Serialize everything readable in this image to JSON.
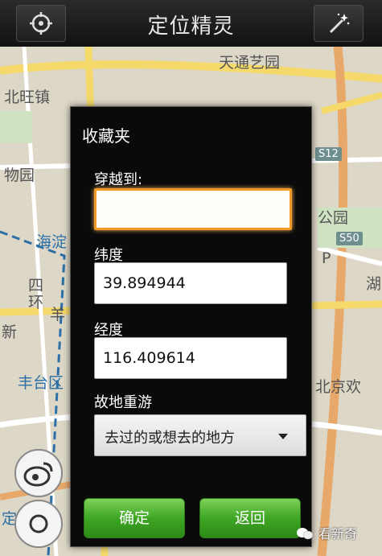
{
  "app": {
    "title": "定位精灵"
  },
  "map": {
    "labels": [
      "天通艺园",
      "北旺镇",
      "物园",
      "海淀",
      "公园",
      "四",
      "环",
      "羊",
      "新",
      "丰台区",
      "北京欢",
      "定河",
      "P",
      "湖"
    ],
    "road_badges": [
      "S12",
      "S50"
    ]
  },
  "dialog": {
    "title": "收藏夹",
    "goto_label": "穿越到:",
    "goto_value": "",
    "lat_label": "纬度",
    "lat_value": "39.894944",
    "lng_label": "经度",
    "lng_value": "116.409614",
    "revisit_label": "故地重游",
    "revisit_selected": "去过的或想去的地方",
    "ok_label": "确定",
    "back_label": "返回"
  },
  "watermark": {
    "text": "看新奇"
  },
  "colors": {
    "focus_border": "#f39b2a",
    "button_green": "#3ea624",
    "dialog_bg": "#0a0a0a"
  },
  "icons": {
    "left_button": "locate-icon",
    "right_button": "magic-wand-icon"
  }
}
